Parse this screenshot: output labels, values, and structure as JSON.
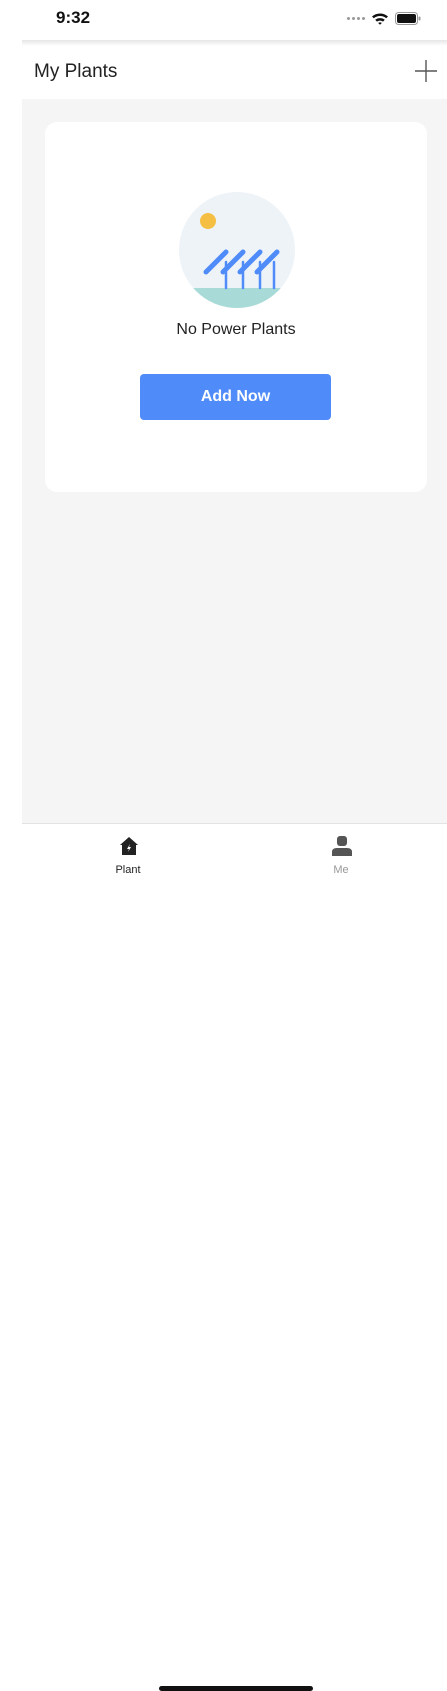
{
  "status_bar": {
    "time": "9:32"
  },
  "header": {
    "title": "My Plants",
    "add_icon": "plus-icon"
  },
  "empty_state": {
    "message": "No Power Plants",
    "button_label": "Add Now",
    "illustration": "solar-panels-illustration"
  },
  "tab_bar": {
    "tabs": [
      {
        "label": "Plant",
        "icon": "home-icon",
        "active": true
      },
      {
        "label": "Me",
        "icon": "person-icon",
        "active": false
      }
    ]
  },
  "colors": {
    "accent": "#4f8cfa",
    "background": "#f5f5f5",
    "card": "#ffffff",
    "active_tab": "#222222",
    "inactive_tab": "#999999"
  }
}
